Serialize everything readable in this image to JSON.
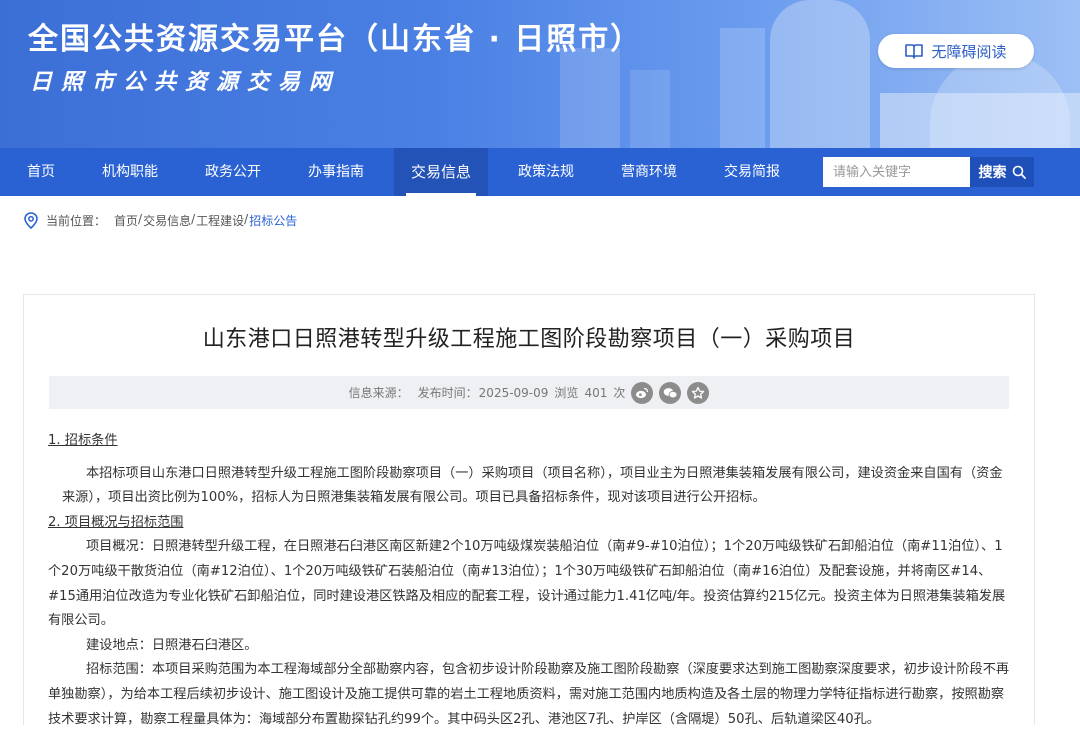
{
  "header": {
    "title": "全国公共资源交易平台（山东省 · 日照市）",
    "subtitle": "日照市公共资源交易网",
    "accessibility_label": "无障碍阅读"
  },
  "nav": {
    "items": [
      "首页",
      "机构职能",
      "政务公开",
      "办事指南",
      "交易信息",
      "政策法规",
      "营商环境",
      "交易简报"
    ],
    "active": "交易信息",
    "search_placeholder": "请输入关键字",
    "search_label": "搜索"
  },
  "breadcrumb": {
    "prefix": "当前位置：",
    "items": [
      "首页",
      "交易信息",
      "工程建设"
    ],
    "current": "招标公告",
    "separator": "/"
  },
  "article": {
    "title": "山东港口日照港转型升级工程施工图阶段勘察项目（一）采购项目",
    "meta": {
      "source_label": "信息来源：",
      "date_label": "发布时间：",
      "date": "2025-09-09",
      "views_label": "浏览",
      "views": "401",
      "views_unit": "次"
    },
    "share_icons": [
      "weibo-icon",
      "wechat-icon",
      "favorite-icon"
    ],
    "sections": [
      {
        "heading": "1.    招标条件"
      },
      {
        "para": "本招标项目山东港口日照港转型升级工程施工图阶段勘察项目（一）采购项目（项目名称），项目业主为日照港集装箱发展有限公司，建设资金来自国有（资金来源），项目出资比例为100%，招标人为日照港集装箱发展有限公司。项目已具备招标条件，现对该项目进行公开招标。"
      },
      {
        "heading": "2.    项目概况与招标范围"
      },
      {
        "para": "项目概况：日照港转型升级工程，在日照港石臼港区南区新建2个10万吨级煤炭装船泊位（南#9-#10泊位）；1个20万吨级铁矿石卸船泊位（南#11泊位）、1个20万吨级干散货泊位（南#12泊位）、1个20万吨级铁矿石装船泊位（南#13泊位）；1个30万吨级铁矿石卸船泊位（南#16泊位）及配套设施，并将南区#14、#15通用泊位改造为专业化铁矿石卸船泊位，同时建设港区铁路及相应的配套工程，设计通过能力1.41亿吨/年。投资估算约215亿元。投资主体为日照港集装箱发展有限公司。"
      },
      {
        "para": "建设地点：日照港石臼港区。"
      },
      {
        "para": "招标范围：本项目采购范围为本工程海域部分全部勘察内容，包含初步设计阶段勘察及施工图阶段勘察（深度要求达到施工图勘察深度要求，初步设计阶段不再单独勘察），为给本工程后续初步设计、施工图设计及施工提供可靠的岩土工程地质资料，需对施工范围内地质构造及各土层的物理力学特征指标进行勘察，按照勘察技术要求计算，勘察工程量具体为：海域部分布置勘探钻孔约99个。其中码头区2孔、港池区7孔、护岸区（含隔堤）50孔、后轨道梁区40孔。"
      }
    ]
  }
}
